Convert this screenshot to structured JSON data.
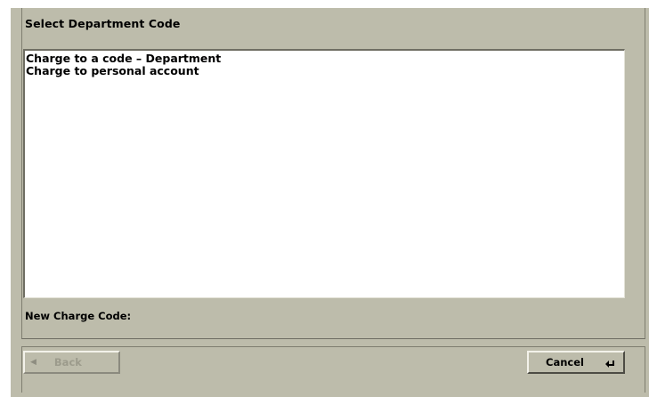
{
  "dialog": {
    "title": "Select Department Code"
  },
  "list": {
    "items": [
      "Charge to a code – Department",
      "Charge to personal account"
    ]
  },
  "charge_code": {
    "label": "New Charge Code:"
  },
  "buttons": {
    "back_label": "Back",
    "back_icon": "left-arrow-icon",
    "cancel_label": "Cancel",
    "cancel_icon": "enter-key-icon"
  },
  "colors": {
    "panel_background": "#bdbcab",
    "list_background": "#ffffff",
    "disabled_text": "#9c9b8c"
  }
}
